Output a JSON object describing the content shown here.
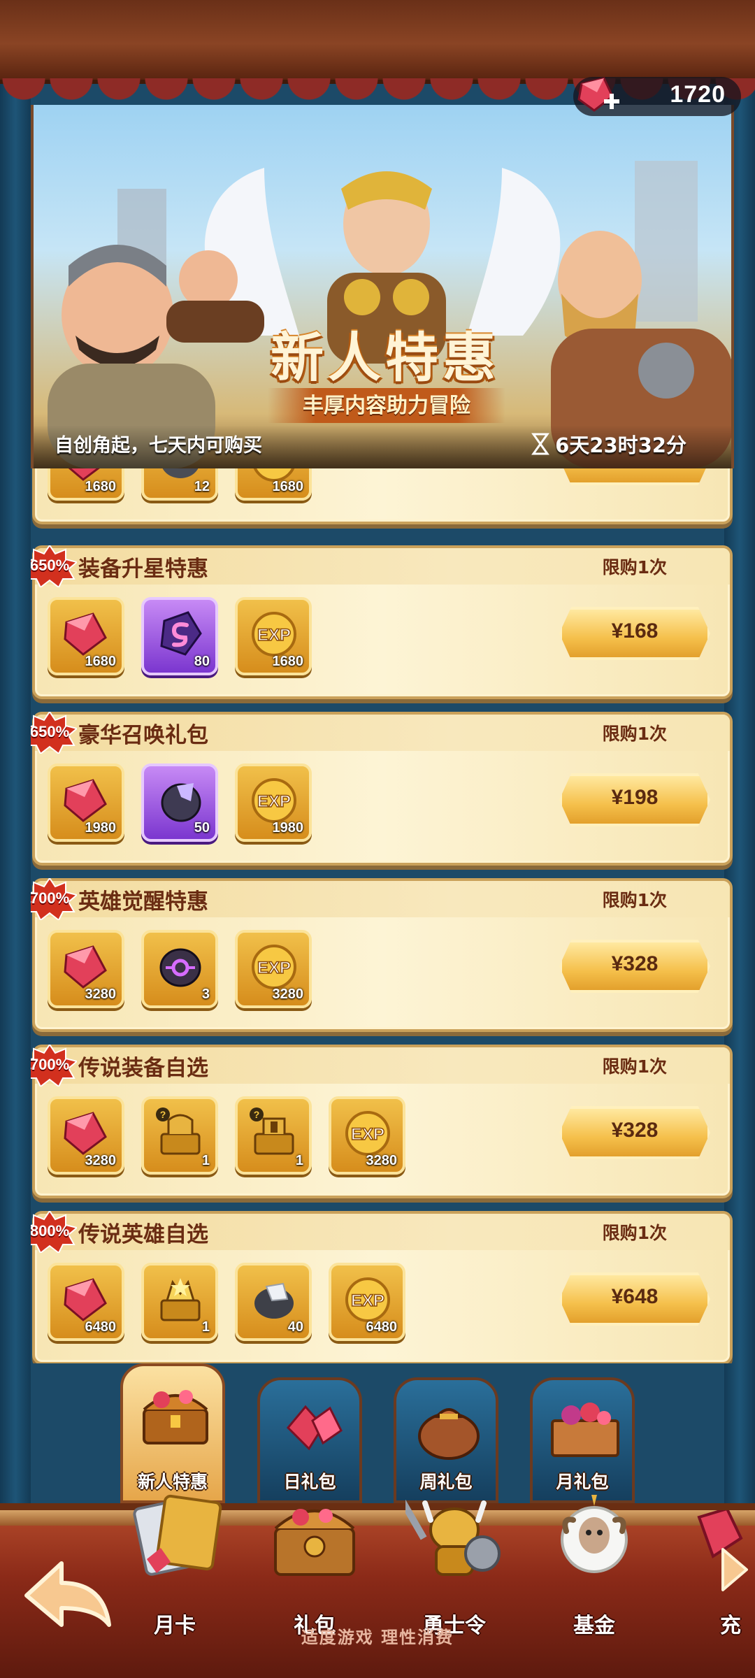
{
  "header": {
    "gem_balance": "1720",
    "icons": {
      "gem_plus": "gem-plus-icon"
    }
  },
  "banner": {
    "title": "新人特惠",
    "subtitle": "丰厚内容助力冒险",
    "note": "自创角起，七天内可购买",
    "timer": "6天23时32分"
  },
  "offers": [
    {
      "name": "",
      "limit": "",
      "discount": "",
      "price": "",
      "items": [
        {
          "icon": "ruby-icon",
          "qty": "1680",
          "tier": "gold"
        },
        {
          "icon": "ore-stone-icon",
          "qty": "12",
          "tier": "gold"
        },
        {
          "icon": "exp-icon",
          "qty": "1680",
          "tier": "gold"
        }
      ]
    },
    {
      "name": "装备升星特惠",
      "limit": "限购1次",
      "discount": "650%",
      "price": "¥168",
      "items": [
        {
          "icon": "ruby-icon",
          "qty": "1680",
          "tier": "gold"
        },
        {
          "icon": "upgrade-stone-icon",
          "qty": "80",
          "tier": "purple"
        },
        {
          "icon": "exp-icon",
          "qty": "1680",
          "tier": "gold"
        }
      ]
    },
    {
      "name": "豪华召唤礼包",
      "limit": "限购1次",
      "discount": "650%",
      "price": "¥198",
      "items": [
        {
          "icon": "ruby-icon",
          "qty": "1980",
          "tier": "gold"
        },
        {
          "icon": "summon-stone-icon",
          "qty": "50",
          "tier": "purple"
        },
        {
          "icon": "exp-icon",
          "qty": "1980",
          "tier": "gold"
        }
      ]
    },
    {
      "name": "英雄觉醒特惠",
      "limit": "限购1次",
      "discount": "700%",
      "price": "¥328",
      "items": [
        {
          "icon": "ruby-icon",
          "qty": "3280",
          "tier": "gold"
        },
        {
          "icon": "awaken-stone-icon",
          "qty": "3",
          "tier": "gold"
        },
        {
          "icon": "exp-icon",
          "qty": "3280",
          "tier": "gold"
        }
      ]
    },
    {
      "name": "传说装备自选",
      "limit": "限购1次",
      "discount": "700%",
      "price": "¥328",
      "items": [
        {
          "icon": "ruby-icon",
          "qty": "3280",
          "tier": "gold"
        },
        {
          "icon": "legendary-weapon-chest-icon",
          "qty": "1",
          "tier": "gold"
        },
        {
          "icon": "legendary-armor-chest-icon",
          "qty": "1",
          "tier": "gold"
        },
        {
          "icon": "exp-icon",
          "qty": "3280",
          "tier": "gold"
        }
      ]
    },
    {
      "name": "传说英雄自选",
      "limit": "限购1次",
      "discount": "800%",
      "price": "¥648",
      "items": [
        {
          "icon": "ruby-icon",
          "qty": "6480",
          "tier": "gold"
        },
        {
          "icon": "legendary-hero-chest-icon",
          "qty": "1",
          "tier": "gold"
        },
        {
          "icon": "silver-ore-icon",
          "qty": "40",
          "tier": "gold"
        },
        {
          "icon": "exp-icon",
          "qty": "6480",
          "tier": "gold"
        }
      ]
    }
  ],
  "tabs": [
    {
      "label": "新人特惠",
      "icon": "treasure-chest-icon",
      "active": true
    },
    {
      "label": "日礼包",
      "icon": "gem-pile-icon",
      "active": false
    },
    {
      "label": "周礼包",
      "icon": "money-bag-icon",
      "active": false
    },
    {
      "label": "月礼包",
      "icon": "gem-crate-icon",
      "active": false
    }
  ],
  "bottom_nav": [
    {
      "label": "月卡",
      "icon": "month-card-icon"
    },
    {
      "label": "礼包",
      "icon": "gift-chest-icon"
    },
    {
      "label": "勇士令",
      "icon": "warrior-pass-icon"
    },
    {
      "label": "基金",
      "icon": "fund-sheep-icon"
    },
    {
      "label": "充",
      "icon": "recharge-icon"
    }
  ],
  "footer": "适度游戏 理性消费",
  "colors": {
    "card_bg": "#fdf4d5",
    "title_text": "#6a2c12",
    "price_button": "#f5c04b",
    "badge_red": "#d2301e",
    "nav_bg": "#8b2a18"
  }
}
